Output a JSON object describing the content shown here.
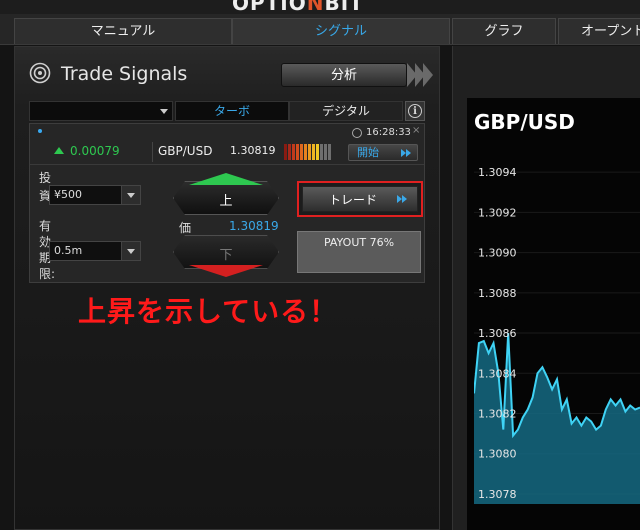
{
  "app": {
    "logo_left": "OPTIO",
    "logo_accent": "N",
    "logo_right": "BIT"
  },
  "nav": {
    "tabs": [
      {
        "label": "マニュアル",
        "active": false
      },
      {
        "label": "シグナル",
        "active": true
      },
      {
        "label": "グラフ",
        "active": false
      },
      {
        "label": "オープントレ",
        "active": false
      }
    ]
  },
  "signals": {
    "title": "Trade Signals",
    "analysis_label": "分析",
    "filters": {
      "first": "",
      "turbo": "ターボ",
      "digital": "デジタル",
      "info_icon": "i"
    },
    "card": {
      "time": "16:28:33",
      "close": "×",
      "change": "0.00079",
      "pair": "GBP/USD",
      "price": "1.30819",
      "start_label": "開始"
    },
    "form": {
      "investment_label_1": "投",
      "investment_label_2": "資",
      "investment_value": "¥500",
      "expiry_label_1": "有",
      "expiry_label_2": "効",
      "expiry_label_3": "期",
      "expiry_label_4": "限:",
      "expiry_value": "0.5m",
      "up_label": "上",
      "down_label": "下",
      "price_label": "価",
      "price_value": "1.30819",
      "trade_label": "トレード",
      "payout_label": "PAYOUT 76%"
    },
    "annotation": "上昇を示している！"
  },
  "chart_data": {
    "type": "area",
    "title": "GBP/USD",
    "xlabel": "",
    "ylabel": "",
    "ylim": [
      1.30775,
      1.30955
    ],
    "y_ticks": [
      "1.3094",
      "1.3092",
      "1.3090",
      "1.3088",
      "1.3086",
      "1.3084",
      "1.3082",
      "1.3080",
      "1.3078"
    ],
    "x": [
      0,
      1,
      2,
      3,
      4,
      5,
      6,
      7,
      8,
      9,
      10,
      11,
      12,
      13,
      14,
      15,
      16,
      17,
      18,
      19,
      20,
      21,
      22,
      23,
      24,
      25,
      26,
      27,
      28,
      29,
      30,
      31,
      32,
      33,
      34
    ],
    "values": [
      1.3083,
      1.30855,
      1.30856,
      1.3085,
      1.30855,
      1.3084,
      1.30812,
      1.3086,
      1.30809,
      1.30812,
      1.30818,
      1.30822,
      1.30828,
      1.3084,
      1.30843,
      1.30838,
      1.30832,
      1.30837,
      1.30822,
      1.30827,
      1.30815,
      1.30818,
      1.30814,
      1.30818,
      1.30816,
      1.30812,
      1.30814,
      1.30822,
      1.30827,
      1.30824,
      1.30827,
      1.30821,
      1.30824,
      1.30822,
      1.30823
    ],
    "line_color": "#3fd3f5",
    "fill_color": "#156a82"
  }
}
